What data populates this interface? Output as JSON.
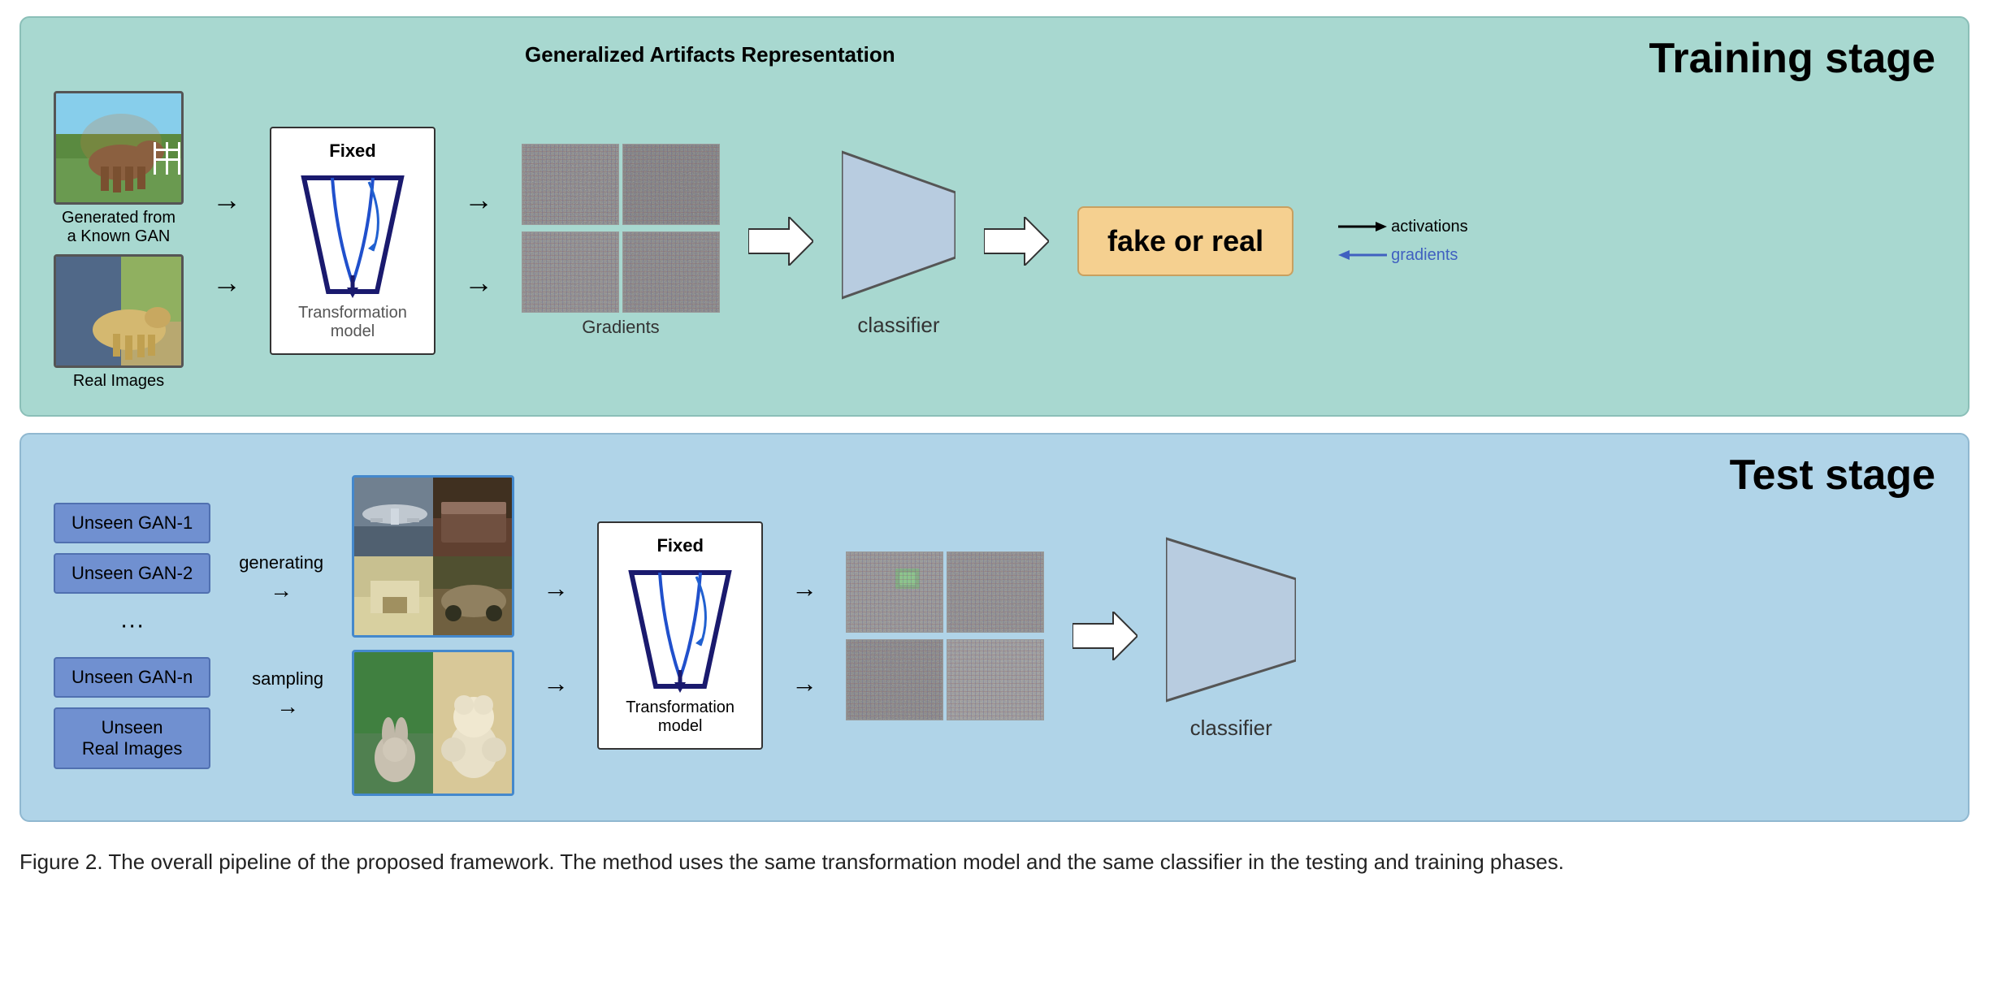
{
  "training_panel": {
    "title": "Training stage",
    "gar_label": "Generalized Artifacts Representation",
    "image1_label": "Generated from\na Known GAN",
    "image2_label": "Real Images",
    "transform_title": "Fixed",
    "transform_subtitle": "Transformation\nmodel",
    "gradients_label": "Gradients",
    "classifier_label": "classifier",
    "fake_real_label": "fake or real",
    "legend_activations": "activations",
    "legend_gradients": "gradients"
  },
  "test_panel": {
    "title": "Test stage",
    "gan_list": [
      "Unseen GAN-1",
      "Unseen GAN-2",
      "···",
      "Unseen GAN-n",
      "Unseen\nReal Images"
    ],
    "generating_label": "generating",
    "sampling_label": "sampling",
    "transform_title": "Fixed",
    "transform_subtitle": "Transformation\nmodel",
    "classifier_label": "classifier"
  },
  "caption": "Figure 2. The overall pipeline of the proposed framework. The method uses the same transformation model and the same classifier in the testing and training phases."
}
